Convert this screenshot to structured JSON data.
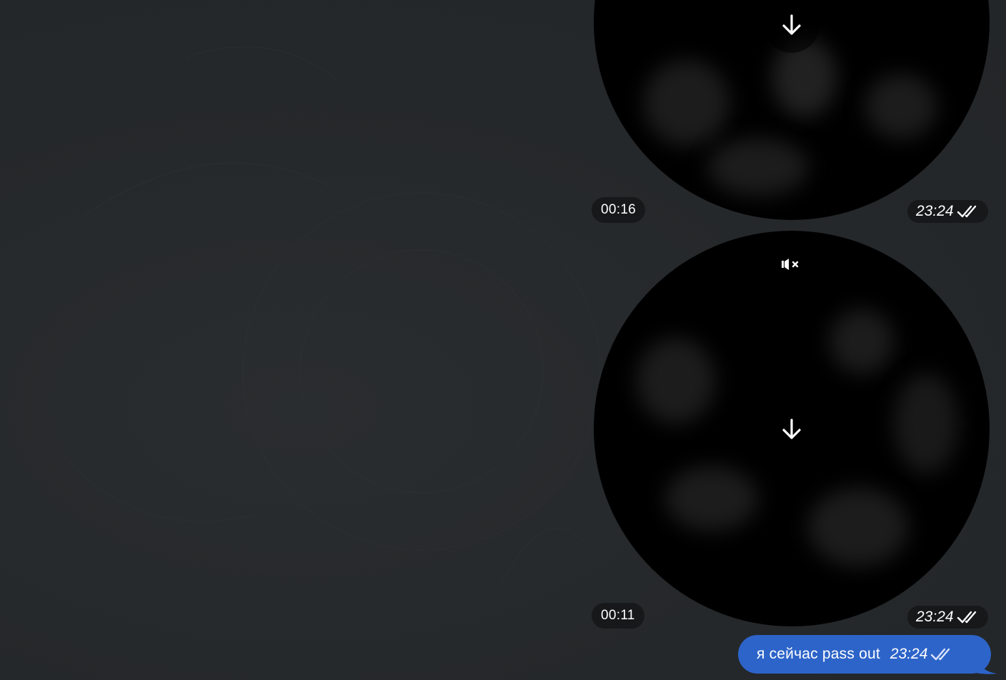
{
  "messages": [
    {
      "type": "video_note",
      "duration": "00:16",
      "time": "23:24",
      "status": "read",
      "download_icon": "arrow-down-icon",
      "status_icon": "double-check-icon"
    },
    {
      "type": "video_note",
      "duration": "00:11",
      "time": "23:24",
      "status": "read",
      "download_icon": "arrow-down-icon",
      "muted_icon": "speaker-muted-icon",
      "status_icon": "double-check-icon"
    },
    {
      "type": "text",
      "text": "я сейчас pass out",
      "time": "23:24",
      "status": "read",
      "status_icon": "double-check-icon"
    }
  ],
  "colors": {
    "chat_background": "#26292b",
    "outgoing_bubble": "#2d64c9",
    "pill_background": "#161819",
    "text": "#ffffff"
  }
}
